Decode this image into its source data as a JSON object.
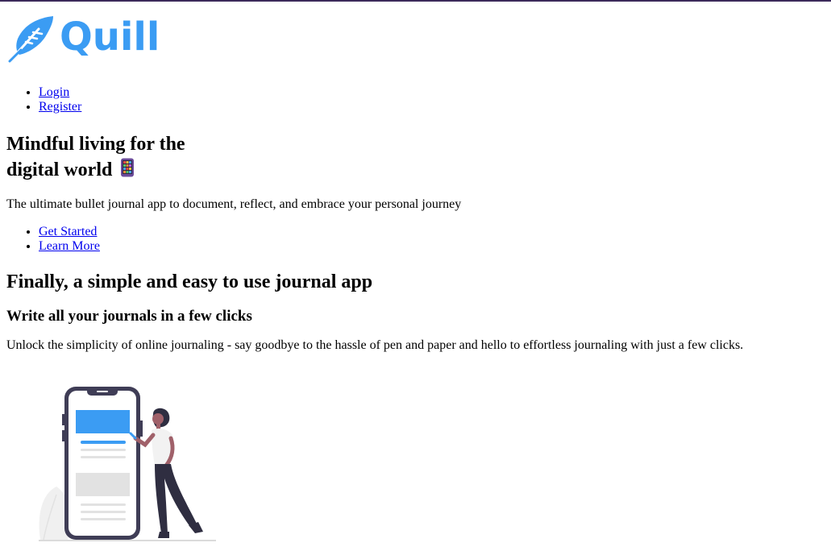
{
  "brand": {
    "name": "Quill",
    "accent": "#3b9cf3"
  },
  "nav": {
    "items": [
      {
        "label": "Login"
      },
      {
        "label": "Register"
      }
    ]
  },
  "hero": {
    "title_line1": "Mindful living for the",
    "title_line2": "digital world",
    "emoji_icon": "phone-grid-icon",
    "subtitle": "The ultimate bullet journal app to document, reflect, and embrace your personal journey",
    "ctas": [
      {
        "label": "Get Started"
      },
      {
        "label": "Learn More"
      }
    ]
  },
  "feature": {
    "heading": "Finally, a simple and easy to use journal app",
    "subheading": "Write all your journals in a few clicks",
    "body": "Unlock the simplicity of online journaling - say goodbye to the hassle of pen and paper and hello to effortless journaling with just a few clicks."
  }
}
